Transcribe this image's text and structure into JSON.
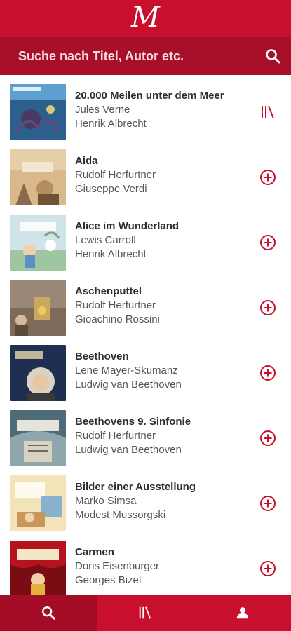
{
  "app": {
    "logo_letter": "M"
  },
  "search": {
    "placeholder": "Suche nach Titel, Autor etc."
  },
  "colors": {
    "brand": "#c8102e",
    "brand_dark": "#a8102a",
    "accent_icon": "#c8102e"
  },
  "books": [
    {
      "title": "20.000 Meilen unter dem Meer",
      "author": "Jules Verne",
      "narrator": "Henrik Albrecht",
      "action": "library-icon"
    },
    {
      "title": "Aida",
      "author": "Rudolf Herfurtner",
      "narrator": "Giuseppe Verdi",
      "action": "add-circle-icon"
    },
    {
      "title": "Alice im Wunderland",
      "author": "Lewis Carroll",
      "narrator": "Henrik Albrecht",
      "action": "add-circle-icon"
    },
    {
      "title": "Aschenputtel",
      "author": "Rudolf Herfurtner",
      "narrator": "Gioachino Rossini",
      "action": "add-circle-icon"
    },
    {
      "title": "Beethoven",
      "author": "Lene Mayer-Skumanz",
      "narrator": "Ludwig van Beethoven",
      "action": "add-circle-icon"
    },
    {
      "title": "Beethovens 9. Sinfonie",
      "author": "Rudolf Herfurtner",
      "narrator": "Ludwig van Beethoven",
      "action": "add-circle-icon"
    },
    {
      "title": "Bilder einer Ausstellung",
      "author": "Marko Simsa",
      "narrator": "Modest Mussorgski",
      "action": "add-circle-icon"
    },
    {
      "title": "Carmen",
      "author": "Doris Eisenburger",
      "narrator": "Georges Bizet",
      "action": "add-circle-icon"
    }
  ],
  "bottom_nav": [
    {
      "icon": "search-icon",
      "active": true
    },
    {
      "icon": "library-icon",
      "active": false
    },
    {
      "icon": "person-icon",
      "active": false
    }
  ]
}
